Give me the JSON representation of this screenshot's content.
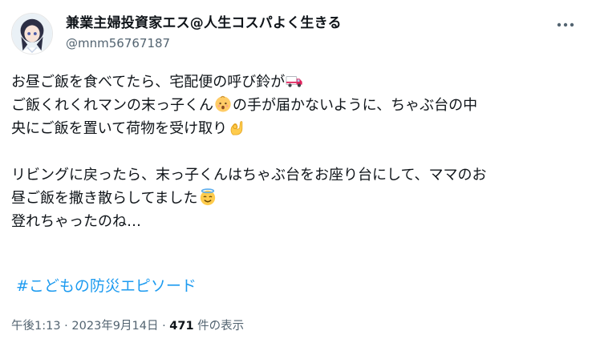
{
  "author": {
    "display_name": "兼業主婦投資家エス@人生コスパよく生きる",
    "handle": "@mnm56767187"
  },
  "more_icon": "more-dots-icon",
  "post": {
    "line1": "お昼ご飯を食べてたら、宅配便の呼び鈴が",
    "emoji1": "delivery-truck-emoji",
    "line2a": "ご飯くれくれマンの末っ子くん",
    "emoji2": "baby-emoji",
    "line2b": "の手が届かないように、ちゃぶ台の中",
    "line3": "央にご飯を置いて荷物を受け取り",
    "emoji3": "ok-hand-emoji",
    "line4": "リビングに戻ったら、末っ子くんはちゃぶ台をお座り台にして、ママのお",
    "line5": "昼ご飯を撒き散らしてました",
    "emoji4": "smiling-face-with-halo-emoji",
    "line6": "登れちゃったのね…",
    "hashtag": "#こどもの防災エピソード"
  },
  "meta": {
    "time": "午後1:13",
    "sep1": " · ",
    "date": "2023年9月14日",
    "sep2": " · ",
    "views_count": "471",
    "views_label": " 件の表示"
  }
}
